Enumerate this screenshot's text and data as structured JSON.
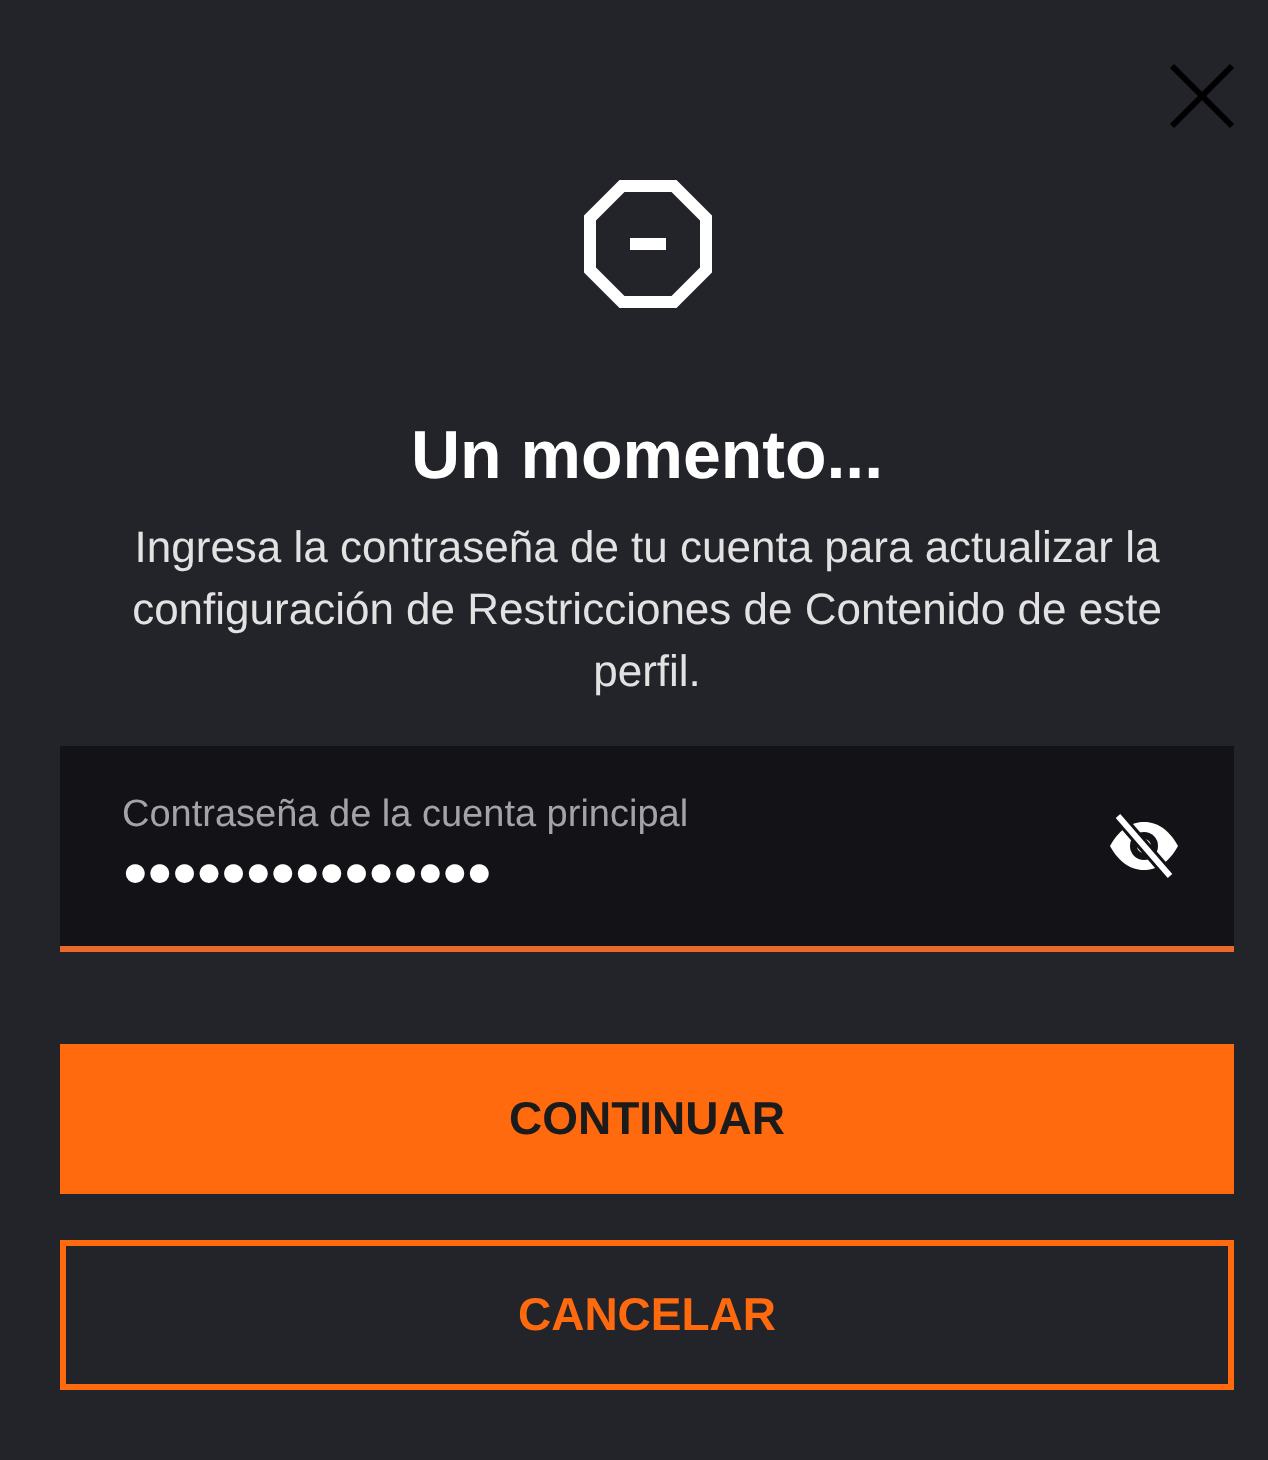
{
  "dialog": {
    "title": "Un momento...",
    "message": "Ingresa la contraseña de tu cuenta para actualizar la configuración de Restricciones de Contenido de este perfil."
  },
  "password_field": {
    "label": "Contraseña de la cuenta principal",
    "value": "●●●●●●●●●●●●●●●",
    "visible": false
  },
  "buttons": [
    {
      "label": "CONTINUAR",
      "kind": "primary"
    },
    {
      "label": "CANCELAR",
      "kind": "secondary"
    }
  ]
}
